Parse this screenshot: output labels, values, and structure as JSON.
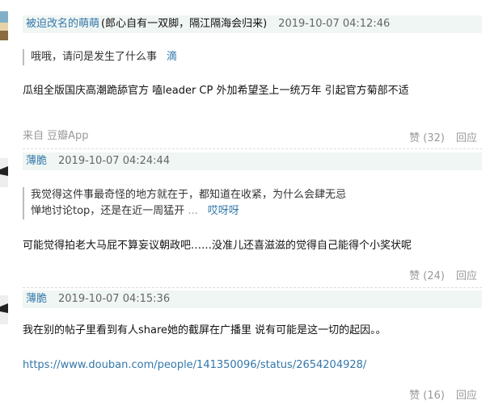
{
  "comments": [
    {
      "author": "被迫改名的萌萌",
      "author_signature": "(郎心自有一双脚，隔江隔海会归来)",
      "time": "2019-10-07 04:12:46",
      "quote_text": "哦哦，请问是发生了什么事",
      "quote_author": "滴",
      "content": "瓜组全版国庆高潮跪舔官方 嗑leader CP 外加希望圣上一统万年 引起官方菊部不适",
      "source_label": "来自",
      "source_app": "豆瓣App",
      "like_label": "赞 (32)",
      "reply_label": "回应"
    },
    {
      "author": "薄脆",
      "time": "2019-10-07 04:24:44",
      "quote_line1": "我觉得这件事最奇怪的地方就在于，都知道在收紧，为什么会肆无忌",
      "quote_line2": "惮地讨论top，还是在近一周猛开",
      "quote_ellipsis": "...",
      "quote_author": "哎呀呀",
      "content": "可能觉得拍老大马屁不算妄议朝政吧……没准儿还喜滋滋的觉得自己能得个小奖状呢",
      "like_label": "赞 (24)",
      "reply_label": "回应"
    },
    {
      "author": "薄脆",
      "time": "2019-10-07 04:15:36",
      "content": "我在别的帖子里看到有人share她的截屏在广播里 说有可能是这一切的起因。。",
      "link": "https://www.douban.com/people/141350096/status/2654204928/",
      "like_label": "赞 (16)",
      "reply_label": "回应"
    }
  ]
}
